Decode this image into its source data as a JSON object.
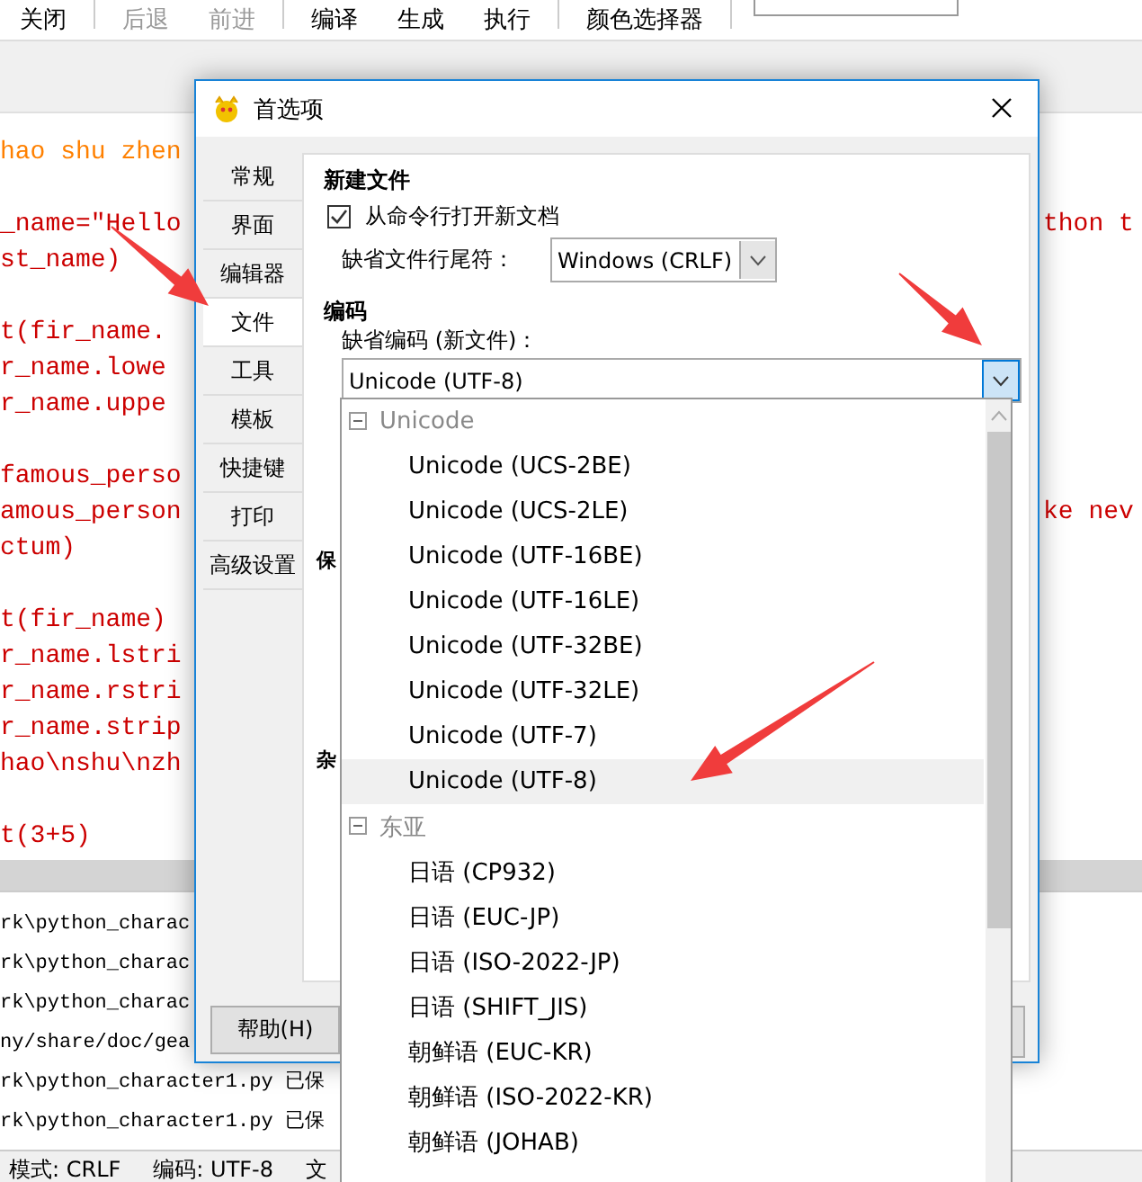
{
  "editor": {
    "toolbar": [
      {
        "kind": "button",
        "label": "关闭",
        "disabled": false
      },
      {
        "kind": "separator"
      },
      {
        "kind": "button",
        "label": "后退",
        "disabled": true
      },
      {
        "kind": "button",
        "label": "前进",
        "disabled": true
      },
      {
        "kind": "separator"
      },
      {
        "kind": "button",
        "label": "编译",
        "disabled": false
      },
      {
        "kind": "button",
        "label": "生成",
        "disabled": false
      },
      {
        "kind": "button",
        "label": "执行",
        "disabled": false
      },
      {
        "kind": "separator"
      },
      {
        "kind": "button",
        "label": "颜色选择器",
        "disabled": false
      },
      {
        "kind": "separator"
      },
      {
        "kind": "search"
      }
    ],
    "code_lines": [
      {
        "kind": "comment",
        "text": "hao shu zhen"
      },
      {
        "kind": "blank"
      },
      {
        "kind": "code",
        "text": "_name=\"Hello",
        "right": "thon t"
      },
      {
        "kind": "code",
        "text": "st_name)"
      },
      {
        "kind": "blank"
      },
      {
        "kind": "code",
        "text": "t(fir_name."
      },
      {
        "kind": "code",
        "text": "r_name.lowe"
      },
      {
        "kind": "code",
        "text": "r_name.uppe"
      },
      {
        "kind": "blank"
      },
      {
        "kind": "code",
        "text": "famous_perso"
      },
      {
        "kind": "code",
        "text": "amous_person",
        "right": "ke nev"
      },
      {
        "kind": "code",
        "text": "ctum)"
      },
      {
        "kind": "blank"
      },
      {
        "kind": "code",
        "text": "t(fir_name)"
      },
      {
        "kind": "code",
        "text": "r_name.lstri"
      },
      {
        "kind": "code",
        "text": "r_name.rstri"
      },
      {
        "kind": "code",
        "text": "r_name.strip"
      },
      {
        "kind": "code",
        "text": "hao\\nshu\\nzh"
      },
      {
        "kind": "blank"
      },
      {
        "kind": "code",
        "text": "t(3+5)"
      }
    ],
    "messages": [
      "rk\\python_charac",
      "rk\\python_charac",
      "rk\\python_charac",
      "ny/share/doc/gea",
      "rk\\python_character1.py 已保",
      "rk\\python_character1.py 已保"
    ],
    "status_bar": [
      "模式: CRLF",
      "编码: UTF-8",
      "文"
    ]
  },
  "dialog": {
    "title": "首选项",
    "tabs": [
      {
        "label": "常规",
        "selected": false
      },
      {
        "label": "界面",
        "selected": false
      },
      {
        "label": "编辑器",
        "selected": false
      },
      {
        "label": "文件",
        "selected": true
      },
      {
        "label": "工具",
        "selected": false
      },
      {
        "label": "模板",
        "selected": false
      },
      {
        "label": "快捷键",
        "selected": false
      },
      {
        "label": "打印",
        "selected": false
      },
      {
        "label": "高级设置",
        "selected": false
      }
    ],
    "new_file": {
      "heading": "新建文件",
      "open_from_cmdline": {
        "label": "从命令行打开新文档",
        "checked": true
      },
      "line_ending": {
        "label": "缺省文件行尾符：",
        "value": "Windows (CRLF)"
      }
    },
    "encoding": {
      "heading": "编码",
      "default_encoding": {
        "label": "缺省编码 (新文件)：",
        "value": "Unicode (UTF-8)",
        "expanded": true
      }
    },
    "partial_headings": [
      "保",
      "杂"
    ],
    "help_button": "帮助(H)"
  },
  "encoding_list": [
    {
      "label": "Unicode",
      "expanded": true,
      "children": [
        {
          "label": "Unicode (UCS-2BE)",
          "selected": false
        },
        {
          "label": "Unicode (UCS-2LE)",
          "selected": false
        },
        {
          "label": "Unicode (UTF-16BE)",
          "selected": false
        },
        {
          "label": "Unicode (UTF-16LE)",
          "selected": false
        },
        {
          "label": "Unicode (UTF-32BE)",
          "selected": false
        },
        {
          "label": "Unicode (UTF-32LE)",
          "selected": false
        },
        {
          "label": "Unicode (UTF-7)",
          "selected": false
        },
        {
          "label": "Unicode (UTF-8)",
          "selected": true
        }
      ]
    },
    {
      "label": "东亚",
      "expanded": true,
      "children": [
        {
          "label": "日语 (CP932)",
          "selected": false
        },
        {
          "label": "日语 (EUC-JP)",
          "selected": false
        },
        {
          "label": "日语 (ISO-2022-JP)",
          "selected": false
        },
        {
          "label": "日语 (SHIFT_JIS)",
          "selected": false
        },
        {
          "label": "朝鲜语 (EUC-KR)",
          "selected": false
        },
        {
          "label": "朝鲜语 (ISO-2022-KR)",
          "selected": false
        },
        {
          "label": "朝鲜语 (JOHAB)",
          "selected": false
        }
      ]
    }
  ],
  "annotations": [
    {
      "kind": "arrow"
    },
    {
      "kind": "arrow"
    },
    {
      "kind": "arrow"
    }
  ]
}
